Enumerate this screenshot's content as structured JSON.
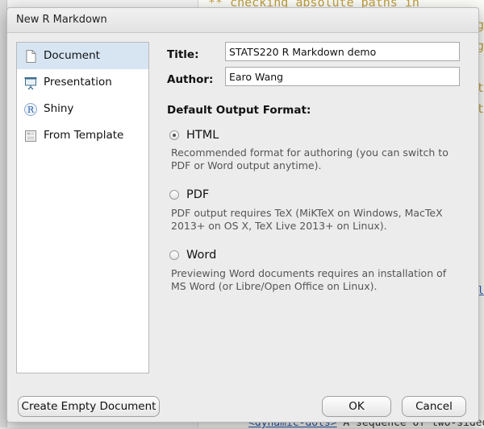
{
  "background": {
    "code_line": "** checking absolute paths in",
    "right_chars": [
      "g",
      "g",
      "t",
      "t"
    ],
    "bottom_tag": "<dynamic-dots>",
    "bottom_text": " A sequence of two-sided",
    "right_link_char": "l"
  },
  "dialog": {
    "title": "New R Markdown",
    "sidebar": [
      {
        "label": "Document",
        "icon": "document-icon",
        "selected": true
      },
      {
        "label": "Presentation",
        "icon": "presentation-icon",
        "selected": false
      },
      {
        "label": "Shiny",
        "icon": "shiny-icon",
        "selected": false
      },
      {
        "label": "From Template",
        "icon": "template-icon",
        "selected": false
      }
    ],
    "title_label": "Title:",
    "title_value": "STATS220 R Markdown demo",
    "author_label": "Author:",
    "author_value": "Earo Wang",
    "output_heading": "Default Output Format:",
    "formats": [
      {
        "label": "HTML",
        "checked": true,
        "desc_line1": "Recommended format for authoring (you can switch to",
        "desc_line2": "PDF or Word output anytime)."
      },
      {
        "label": "PDF",
        "checked": false,
        "desc_line1": "PDF output requires TeX (MiKTeX on Windows, MacTeX",
        "desc_line2": "2013+ on OS X, TeX Live 2013+ on Linux)."
      },
      {
        "label": "Word",
        "checked": false,
        "desc_line1": "Previewing Word documents requires an installation of",
        "desc_line2": "MS Word (or Libre/Open Office on Linux)."
      }
    ],
    "buttons": {
      "create_empty": "Create Empty Document",
      "ok": "OK",
      "cancel": "Cancel"
    }
  }
}
